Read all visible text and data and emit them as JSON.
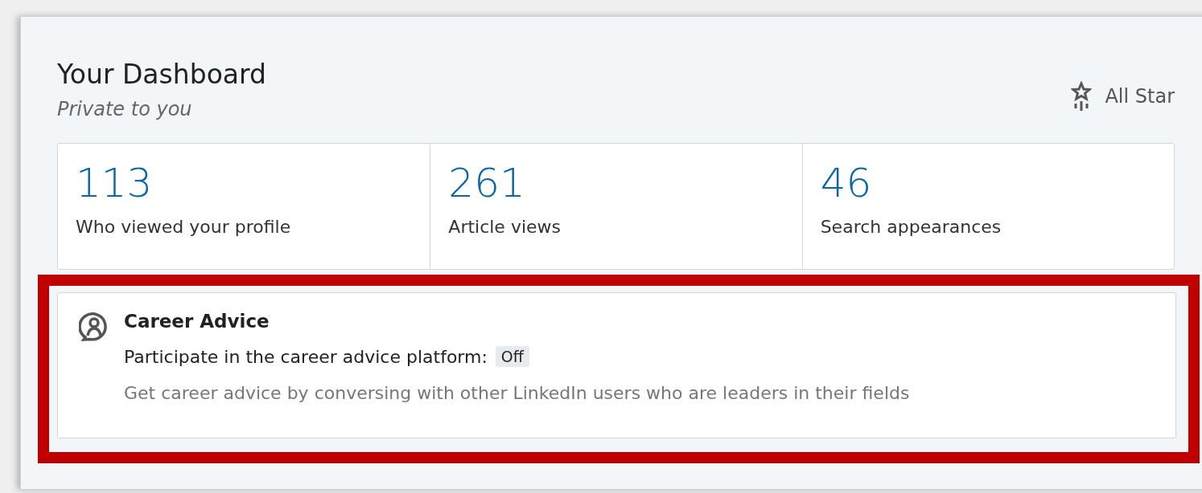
{
  "dashboard": {
    "title": "Your Dashboard",
    "subtitle": "Private to you",
    "badge": {
      "label": "All Star"
    }
  },
  "stats": [
    {
      "value": "113",
      "label": "Who viewed your profile"
    },
    {
      "value": "261",
      "label": "Article views"
    },
    {
      "value": "46",
      "label": "Search appearances"
    }
  ],
  "career_advice": {
    "title": "Career Advice",
    "setting_label": "Participate in the career advice platform:",
    "setting_value": "Off",
    "on": false,
    "description": "Get career advice by conversing with other LinkedIn users who are leaders in their fields",
    "highlighted": true
  }
}
